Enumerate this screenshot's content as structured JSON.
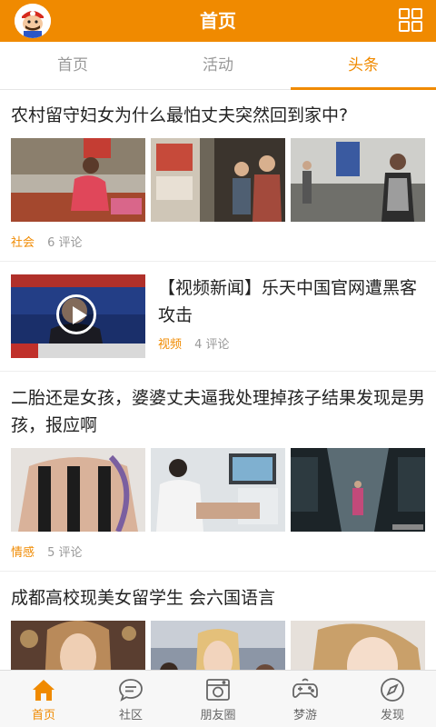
{
  "header": {
    "title": "首页",
    "avatar_icon": "mario-avatar-icon",
    "menu_icon": "grid-icon"
  },
  "tabs": [
    {
      "label": "首页",
      "active": false
    },
    {
      "label": "活动",
      "active": false
    },
    {
      "label": "头条",
      "active": true
    }
  ],
  "articles": [
    {
      "title": "农村留守妇女为什么最怕丈夫突然回到家中?",
      "category": "社会",
      "comments": "6 评论"
    },
    {
      "title": "【视频新闻】乐天中国官网遭黑客攻击",
      "category": "视频",
      "comments": "4 评论"
    },
    {
      "title": "二胎还是女孩，婆婆丈夫逼我处理掉孩子结果发现是男孩，报应啊",
      "category": "情感",
      "comments": "5 评论"
    },
    {
      "title": "成都高校现美女留学生  会六国语言"
    }
  ],
  "bottom_nav": [
    {
      "label": "首页",
      "icon": "home-icon",
      "active": true
    },
    {
      "label": "社区",
      "icon": "chat-bubble-icon",
      "active": false
    },
    {
      "label": "朋友圈",
      "icon": "camera-frame-icon",
      "active": false
    },
    {
      "label": "梦游",
      "icon": "gamepad-icon",
      "active": false
    },
    {
      "label": "发现",
      "icon": "compass-icon",
      "active": false
    }
  ],
  "colors": {
    "accent": "#f08a00",
    "muted": "#999999"
  }
}
